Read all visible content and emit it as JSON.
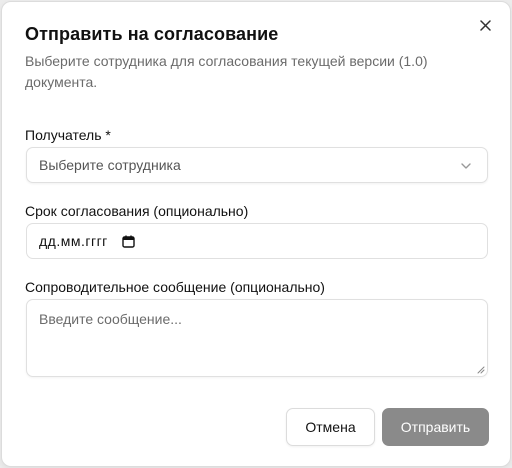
{
  "dialog": {
    "title": "Отправить на согласование",
    "description": "Выберите сотрудника для согласования текущей версии (1.0) документа."
  },
  "recipient": {
    "label": "Получатель *",
    "placeholder": "Выберите сотрудника"
  },
  "deadline": {
    "label": "Срок согласования (опционально)",
    "value": "дд.мм.гггг"
  },
  "message": {
    "label": "Сопроводительное сообщение (опционально)",
    "placeholder": "Введите сообщение..."
  },
  "actions": {
    "cancel_label": "Отмена",
    "submit_label": "Отправить"
  },
  "colors": {
    "submit_disabled_bg": "#8a8a8a",
    "text_muted": "#6b6b6b"
  },
  "icons": {
    "close": "close-icon",
    "chevron": "chevron-down-icon",
    "calendar": "calendar-icon"
  }
}
